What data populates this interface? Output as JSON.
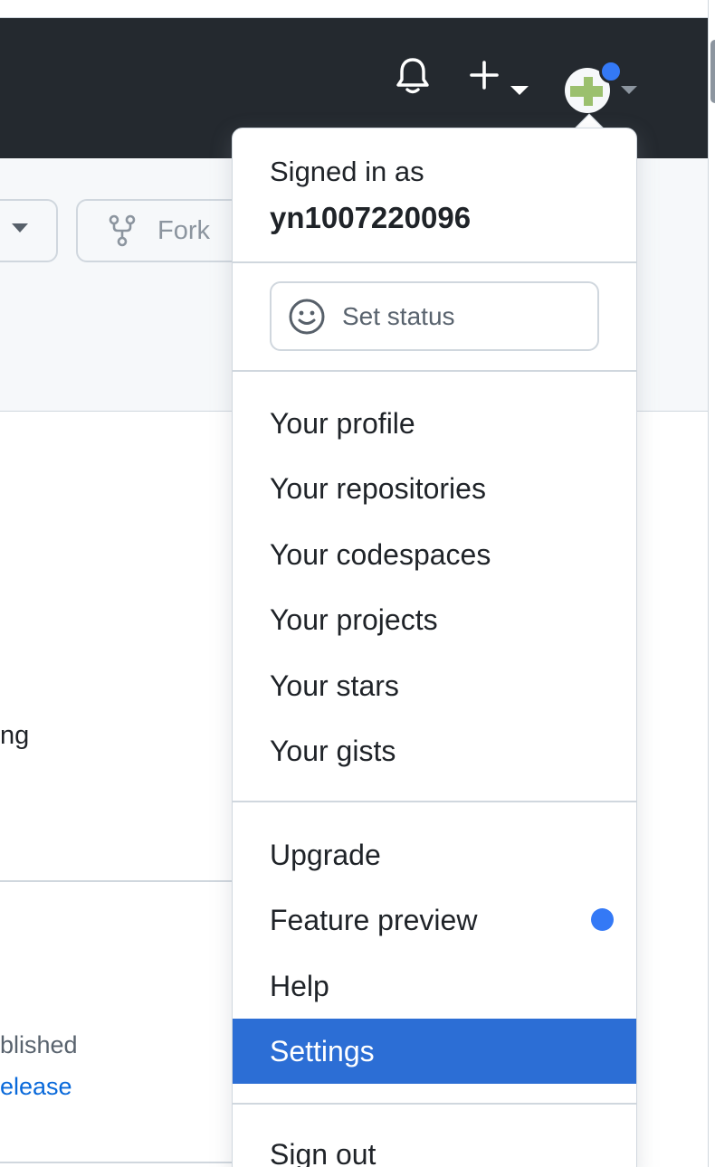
{
  "header": {
    "icons": {
      "notifications": "bell-icon",
      "create": "plus-icon",
      "caret": "chevron-down-icon"
    },
    "badge_color": "#3479f6",
    "background": "#24292f"
  },
  "repo": {
    "fork_label": "Fork",
    "fork_icon": "repo-forked-icon"
  },
  "background_fragments": {
    "line1": "ng",
    "line2": "blished",
    "line3": "elease"
  },
  "menu": {
    "signed_in_label": "Signed in as",
    "username": "yn1007220096",
    "set_status_label": "Set status",
    "set_status_icon": "smiley-icon",
    "group1": [
      "Your profile",
      "Your repositories",
      "Your codespaces",
      "Your projects",
      "Your stars",
      "Your gists"
    ],
    "group2": [
      "Upgrade",
      "Feature preview",
      "Help",
      "Settings"
    ],
    "selected_item": "Settings",
    "sign_out_label": "Sign out",
    "selection_color": "#2c6ed5",
    "new_feature_dot_color": "#3479f6"
  }
}
